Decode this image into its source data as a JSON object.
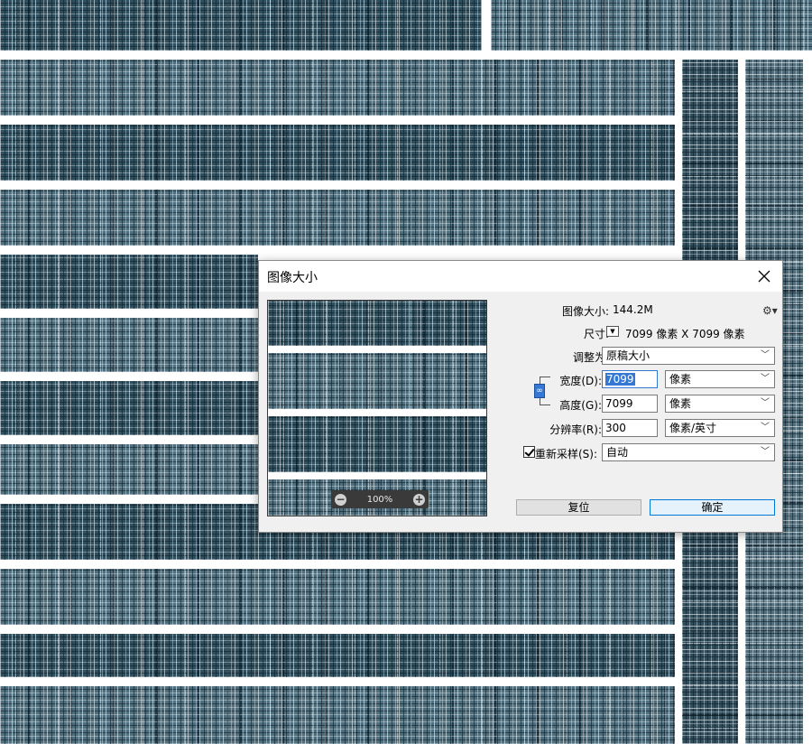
{
  "dialog": {
    "title": "图像大小",
    "image_size_label": "图像大小:",
    "image_size_value": "144.2M",
    "dimensions_label": "尺寸:",
    "dimensions_value": "7099 像素  X  7099 像素",
    "fit_to_label": "调整为:",
    "fit_to_value": "原稿大小",
    "width_label": "宽度(D):",
    "width_value": "7099",
    "width_unit": "像素",
    "height_label": "高度(G):",
    "height_value": "7099",
    "height_unit": "像素",
    "resolution_label": "分辨率(R):",
    "resolution_value": "300",
    "resolution_unit": "像素/英寸",
    "resample_label": "重新采样(S):",
    "resample_checked": true,
    "resample_value": "自动",
    "zoom_level": "100%",
    "reset_label": "复位",
    "ok_label": "确定"
  },
  "colors": {
    "texture": "#2f4f5f",
    "accent": "#3478d3",
    "dialog_bg": "#f0f0f0"
  },
  "icons": {
    "close": "close-icon",
    "gear": "gear-icon",
    "link": "link-icon",
    "zoom_out": "zoom-out-icon",
    "zoom_in": "zoom-in-icon"
  }
}
